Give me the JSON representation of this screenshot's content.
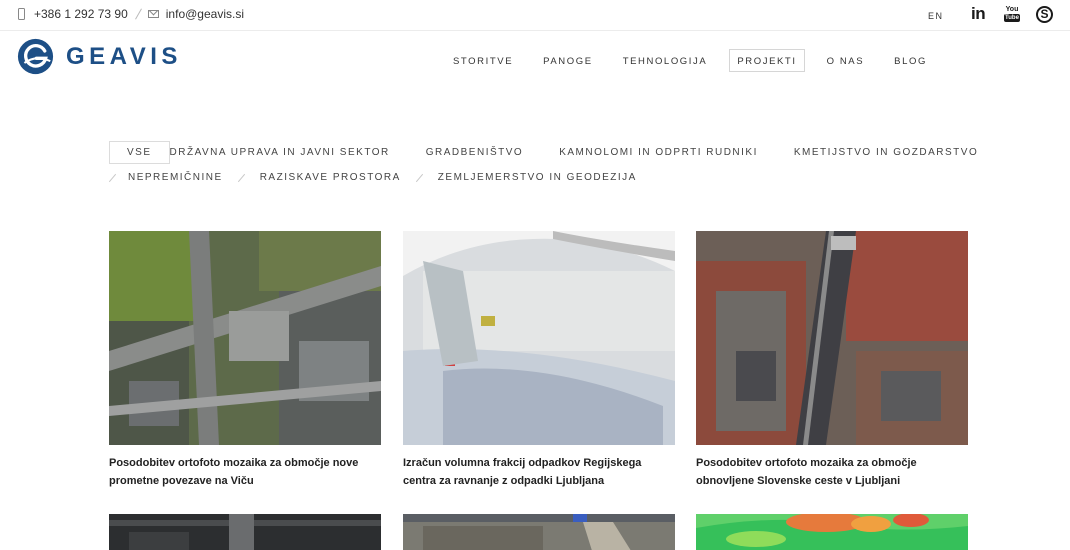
{
  "topbar": {
    "phone": "+386 1 292 73 90",
    "email": "info@geavis.si",
    "language": "EN",
    "social": {
      "linkedin": "in",
      "youtube_top": "You",
      "youtube_bottom": "Tube",
      "skype": "S"
    }
  },
  "header": {
    "logo_text": "GEAVIS",
    "brand_color": "#1d4f86",
    "nav": [
      {
        "label": "STORITVE"
      },
      {
        "label": "PANOGE"
      },
      {
        "label": "TEHNOLOGIJA"
      },
      {
        "label": "PROJEKTI",
        "active": true
      },
      {
        "label": "O NAS"
      },
      {
        "label": "BLOG"
      }
    ]
  },
  "filters": {
    "row1": [
      "VSE",
      "DRŽAVNA UPRAVA IN JAVNI SEKTOR",
      "GRADBENIŠTVO",
      "KAMNOLOMI IN ODPRTI RUDNIKI",
      "KMETIJSTVO IN GOZDARSTVO"
    ],
    "row2": [
      "NEPREMIČNINE",
      "RAZISKAVE PROSTORA",
      "ZEMLJEMERSTVO IN GEODEZIJA"
    ],
    "active": "VSE"
  },
  "projects": [
    {
      "title": "Posodobitev ortofoto mozaika za območje nove prometne povezave na Viču",
      "image": "aerial-road-interchange"
    },
    {
      "title": "Izračun volumna frakcij odpadkov Regijskega centra za ravnanje z odpadki Ljubljana",
      "image": "aerial-waste-site"
    },
    {
      "title": "Posodobitev ortofoto mozaika za območje obnovljene Slovenske ceste v Ljubljani",
      "image": "aerial-city-street"
    }
  ]
}
